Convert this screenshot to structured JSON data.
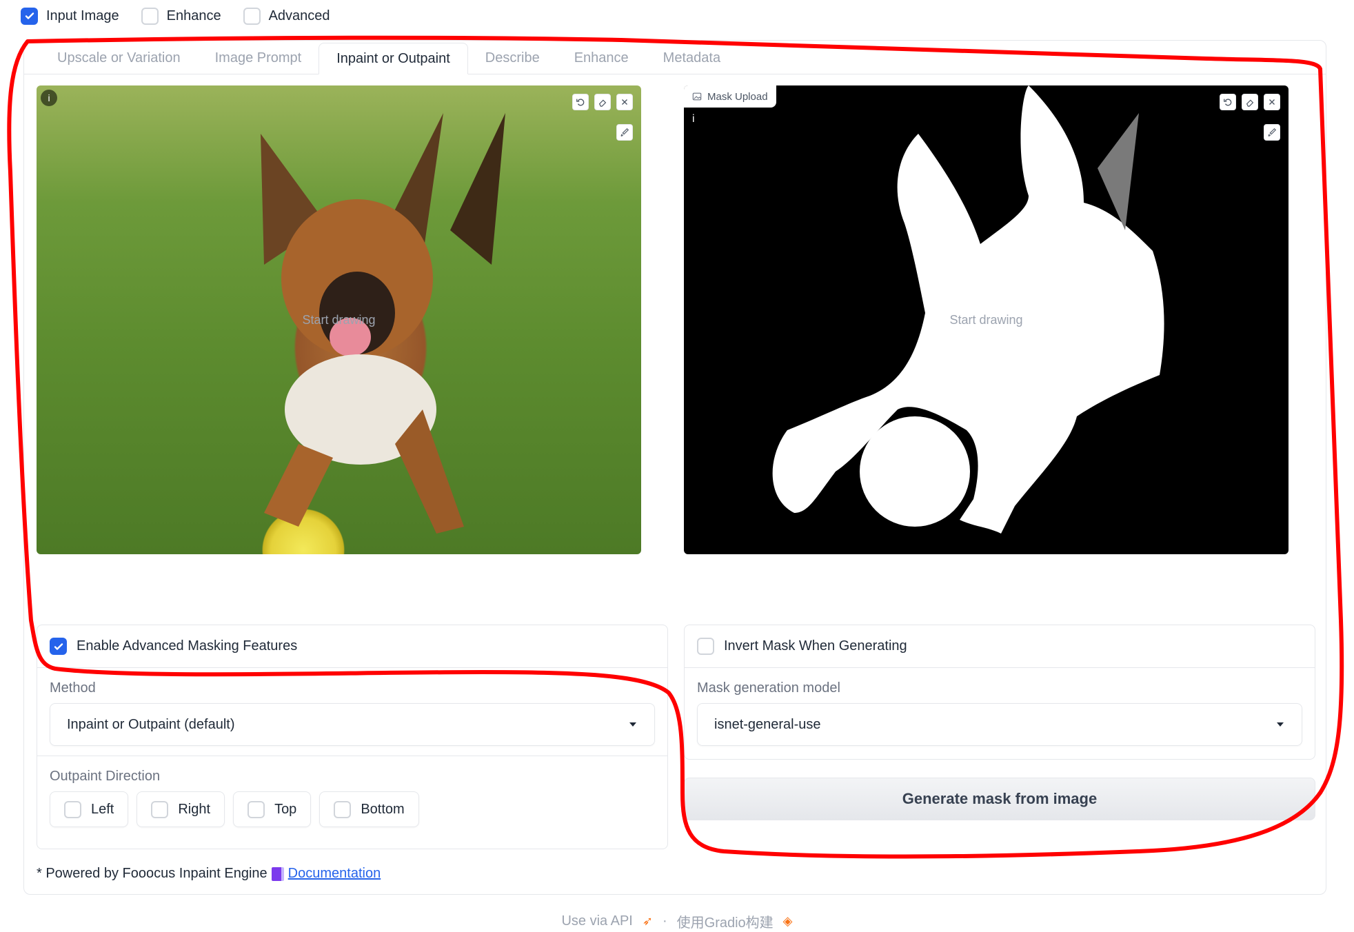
{
  "top_checks": [
    {
      "label": "Input Image",
      "checked": true
    },
    {
      "label": "Enhance",
      "checked": false
    },
    {
      "label": "Advanced",
      "checked": false
    }
  ],
  "tabs": [
    {
      "label": "Upscale or Variation",
      "active": false
    },
    {
      "label": "Image Prompt",
      "active": false
    },
    {
      "label": "Inpaint or Outpaint",
      "active": true
    },
    {
      "label": "Describe",
      "active": false
    },
    {
      "label": "Enhance",
      "active": false
    },
    {
      "label": "Metadata",
      "active": false
    }
  ],
  "left_editor": {
    "placeholder": "Start drawing",
    "info": "i"
  },
  "right_editor": {
    "label": "Mask Upload",
    "placeholder": "Start drawing",
    "info": "i"
  },
  "advanced_masking": {
    "label": "Enable Advanced Masking Features",
    "checked": true
  },
  "method": {
    "label": "Method",
    "value": "Inpaint or Outpaint (default)"
  },
  "outpaint": {
    "label": "Outpaint Direction",
    "options": [
      "Left",
      "Right",
      "Top",
      "Bottom"
    ]
  },
  "invert_mask": {
    "label": "Invert Mask When Generating",
    "checked": false
  },
  "mask_model": {
    "label": "Mask generation model",
    "value": "isnet-general-use"
  },
  "generate_button": "Generate mask from image",
  "powered": {
    "text": "* Powered by Fooocus Inpaint Engine",
    "link": "Documentation"
  },
  "footer": {
    "api": "Use via API",
    "sep": "·",
    "built": "使用Gradio构建"
  },
  "colors": {
    "accent": "#2563eb",
    "annotation": "#ff0000"
  }
}
